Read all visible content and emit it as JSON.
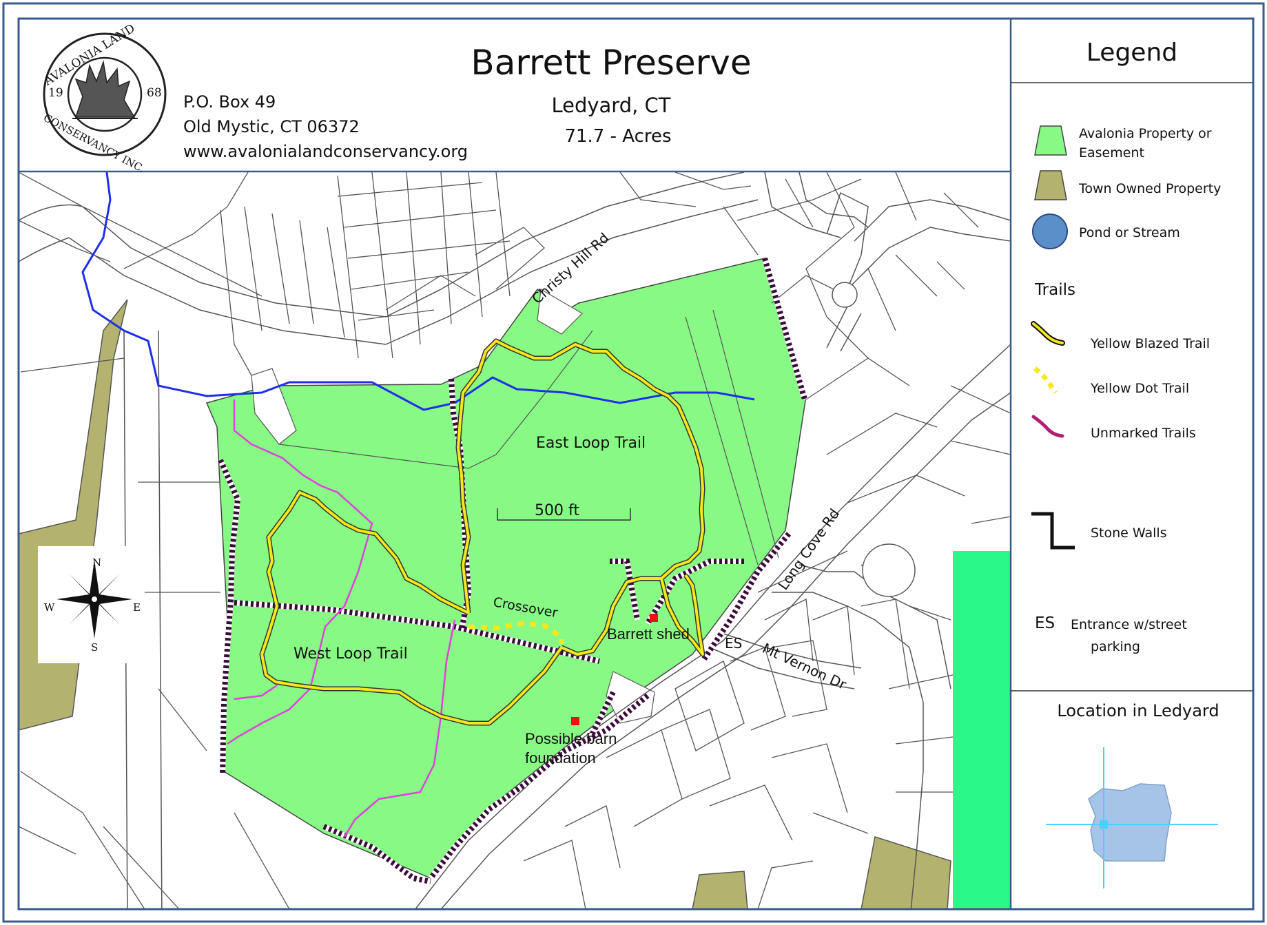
{
  "header": {
    "title": "Barrett Preserve",
    "town": "Ledyard, CT",
    "acres": "71.7 - Acres",
    "address1": "P.O. Box 49",
    "address2": "Old Mystic, CT 06372",
    "website": "www.avalonialandconservancy.org"
  },
  "logo": {
    "ring_top": "AVALONIA LAND",
    "ring_bottom": "CONSERVANCY INC.",
    "year_left": "19",
    "year_right": "68"
  },
  "legend": {
    "title": "Legend",
    "items": [
      {
        "label_line1": "Avalonia Property or",
        "label_line2": "Easement"
      },
      {
        "label_line1": "Town Owned Property",
        "label_line2": ""
      },
      {
        "label_line1": "Pond or Stream",
        "label_line2": ""
      }
    ],
    "trails_heading": "Trails",
    "trails": [
      {
        "label": "Yellow Blazed Trail"
      },
      {
        "label": "Yellow Dot Trail"
      },
      {
        "label": "Unmarked Trails"
      }
    ],
    "stone_walls": "Stone Walls",
    "es_code": "ES",
    "es_line1": "Entrance w/street",
    "es_line2": "parking"
  },
  "location": {
    "title": "Location in Ledyard"
  },
  "map_labels": {
    "christy_hill_rd": "Christy Hill Rd",
    "long_cove_rd": "Long Cove Rd",
    "mt_vernon_dr": "Mt Vernon Dr",
    "east_loop": "East Loop Trail",
    "west_loop": "West Loop Trail",
    "scale": "500 ft",
    "crossover": "Crossover",
    "barrett_shed": "Barrett shed",
    "es": "ES",
    "barn_line1": "Possible barn",
    "barn_line2": "foundation"
  },
  "compass": {
    "n": "N",
    "s": "S",
    "e": "E",
    "w": "W"
  },
  "colors": {
    "frame": "#3a5a8c",
    "avalonia_property": "#88f985",
    "town_property": "#b3b26e",
    "water": "#1f2fe8",
    "pond": "#5b8fc9",
    "yellow_trail": "#f5e81c",
    "unmarked_trail": "#e040e0",
    "stone_wall": "#3a0a3a",
    "bright_green": "#2af98a",
    "marker": "#ee1111"
  }
}
